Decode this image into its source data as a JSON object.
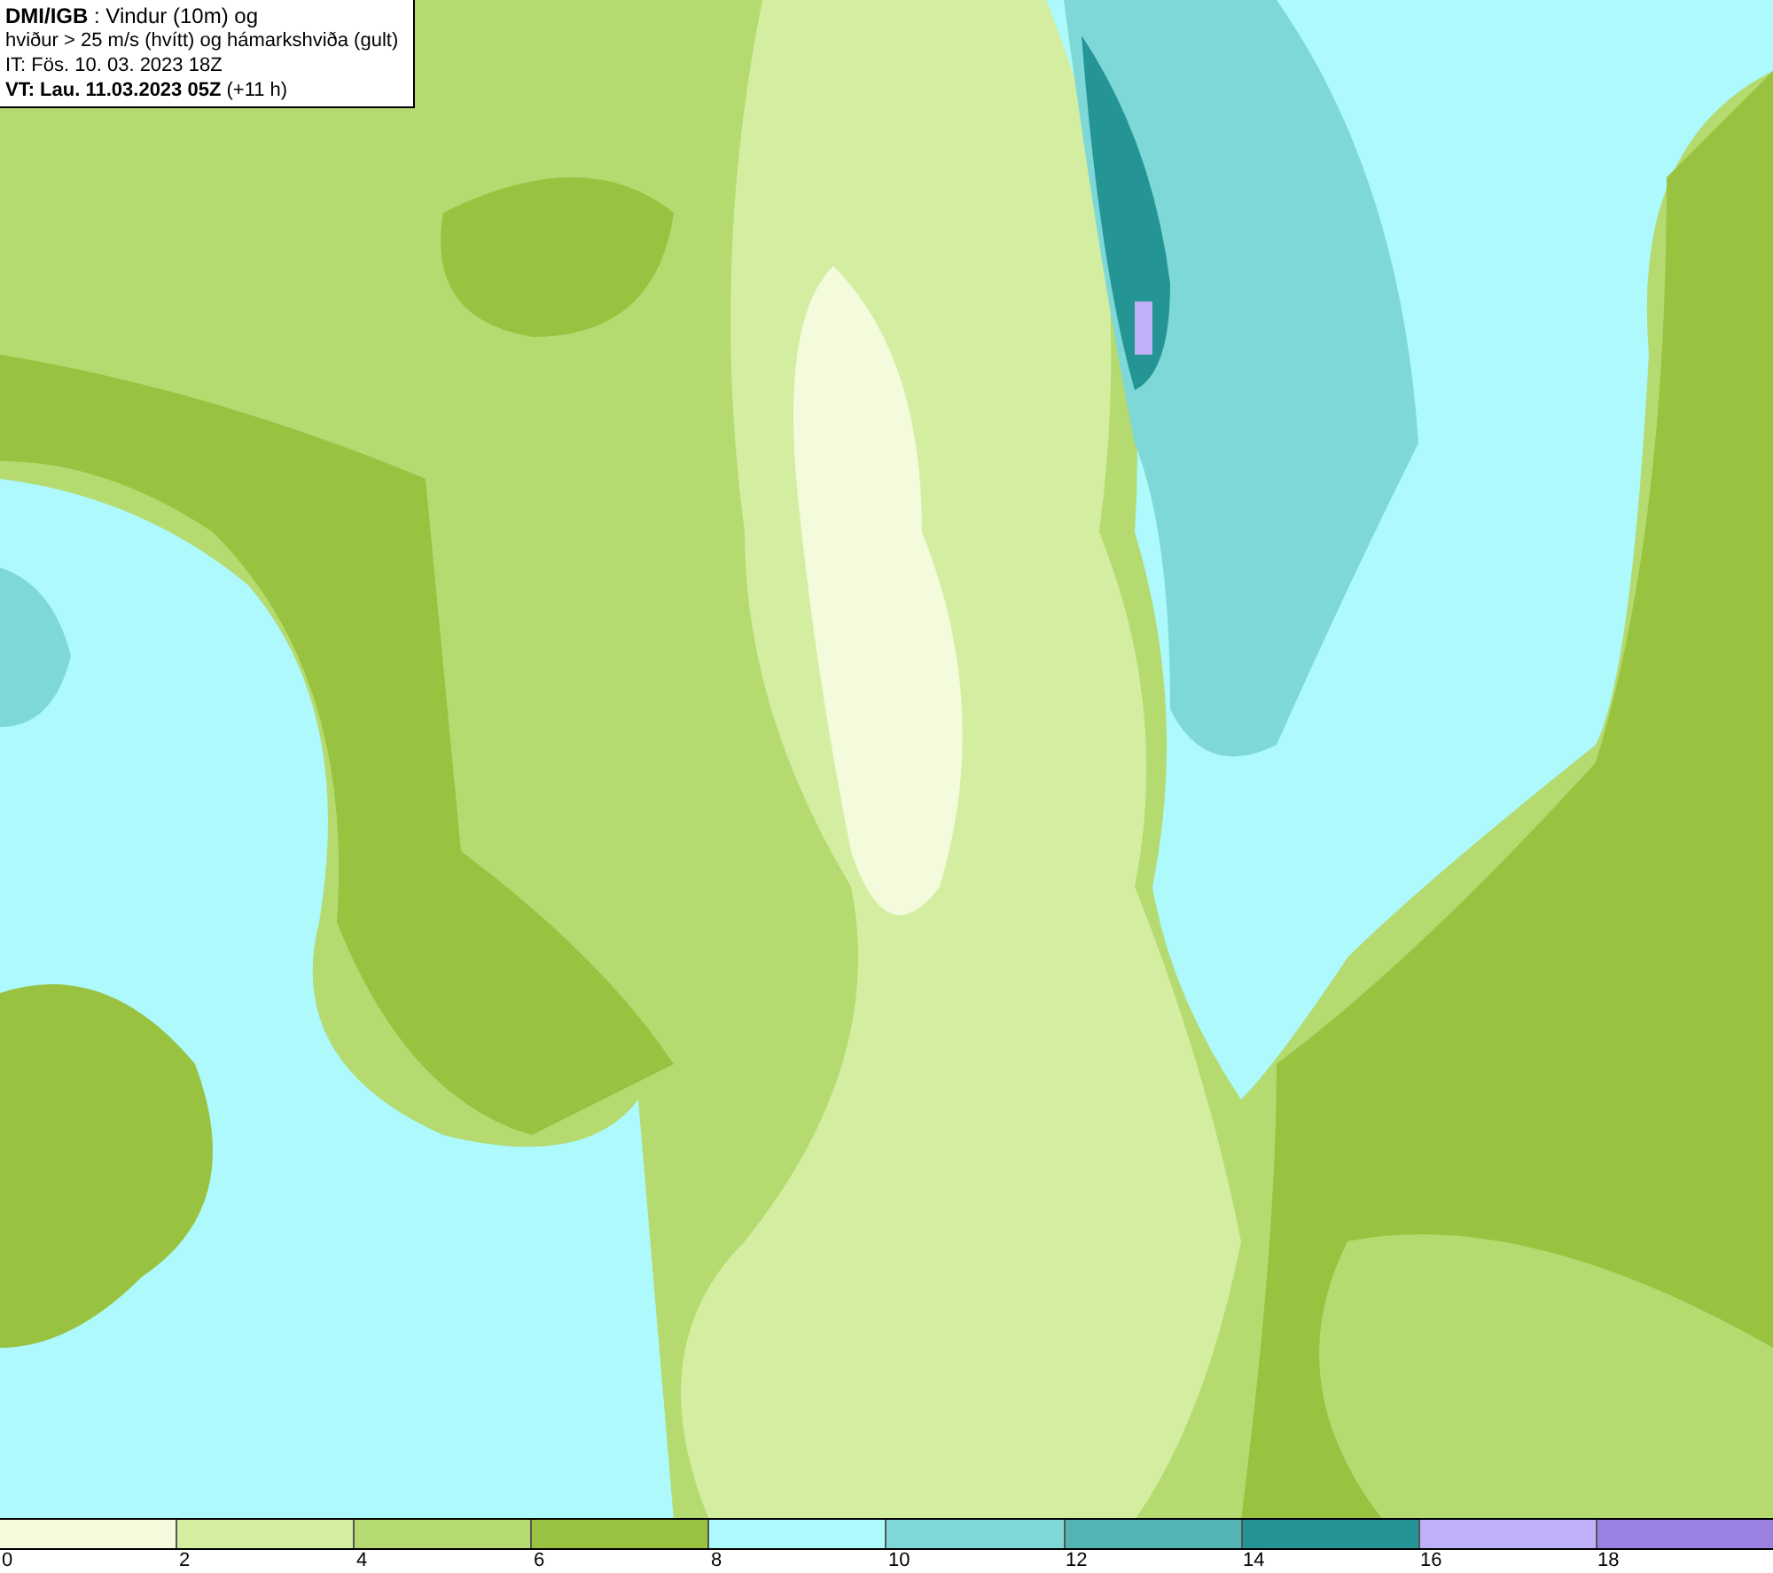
{
  "title_box": {
    "lines": [
      "**DMI/IGB** : Vindur (10m) og",
      "hviður > 25 m/s (hvítt) og hámarkshviða (gult)",
      "IT: Fös. 10. 03. 2023 18Z",
      "**VT: Lau. 11.03.2023 05Z** (+11 h)"
    ]
  },
  "legend": {
    "bins": [
      {
        "color": "#f4fbdc"
      },
      {
        "color": "#d3eea0"
      },
      {
        "color": "#b4da70"
      },
      {
        "color": "#98c240"
      },
      {
        "color": "#adf9fb"
      },
      {
        "color": "#7fd8d8"
      },
      {
        "color": "#54b4b4"
      },
      {
        "color": "#249494"
      },
      {
        "color": "#c0b0f8"
      },
      {
        "color": "#9a80e0"
      }
    ],
    "ticks": [
      "0",
      "2",
      "4",
      "6",
      "8",
      "10",
      "12",
      "14",
      "16",
      "18"
    ]
  }
}
